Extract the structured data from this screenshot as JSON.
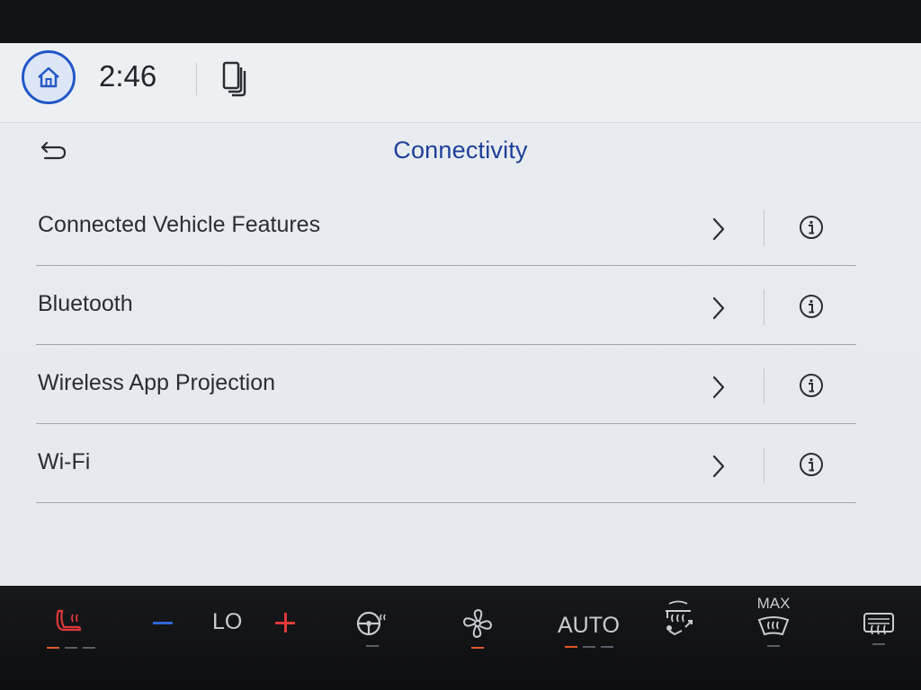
{
  "status": {
    "time": "2:46"
  },
  "header": {
    "title": "Connectivity"
  },
  "menu": {
    "items": [
      {
        "label": "Connected Vehicle Features"
      },
      {
        "label": "Bluetooth"
      },
      {
        "label": "Wireless App Projection"
      },
      {
        "label": "Wi-Fi"
      }
    ]
  },
  "climate": {
    "temp_label": "LO",
    "auto_label": "AUTO",
    "max_label": "MAX"
  },
  "colors": {
    "accent": "#1e3f9a",
    "home_ring": "#2257c8",
    "heat_red": "#e03a3a",
    "cool_blue": "#2f66d9"
  },
  "icons": [
    "home-icon",
    "phone-projection-icon",
    "back-arrow-icon",
    "chevron-right-icon",
    "info-icon",
    "heated-seat-icon",
    "heated-steering-icon",
    "fan-icon",
    "recirculation-icon",
    "max-defrost-icon",
    "rear-defrost-icon"
  ]
}
